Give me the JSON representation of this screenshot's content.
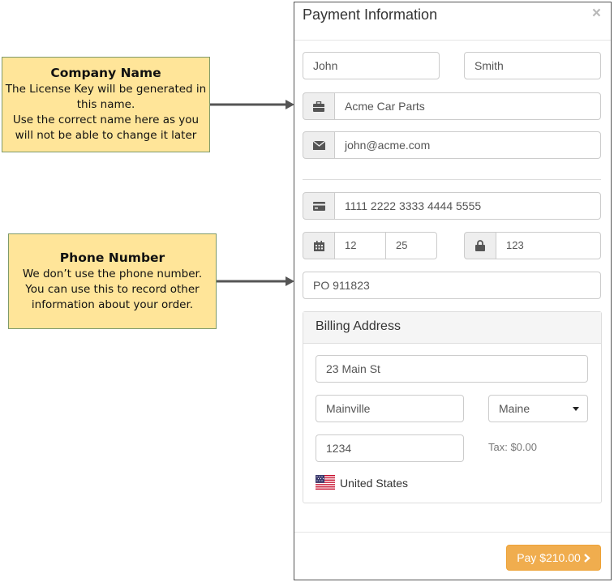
{
  "callouts": {
    "company": {
      "title": "Company Name",
      "body": "The License Key will be generated in\nthis name.\nUse the correct name here as you\nwill not be able to change it later"
    },
    "phone": {
      "title": "Phone Number",
      "body": "We don’t use the phone number.\nYou can use this to record other\ninformation about your order."
    }
  },
  "modal": {
    "title": "Payment Information",
    "close_glyph": "×"
  },
  "form": {
    "first_name": "John",
    "last_name": "Smith",
    "company": "Acme Car Parts",
    "email": "john@acme.com",
    "card_number": "1111 2222 3333 4444 5555",
    "exp_month": "12",
    "exp_year": "25",
    "cvc": "123",
    "phone": "PO 911823"
  },
  "billing": {
    "title": "Billing Address",
    "street": "23 Main St",
    "city": "Mainville",
    "state": "Maine",
    "zip": "1234",
    "tax": "Tax: $0.00",
    "country": "United States"
  },
  "footer": {
    "pay_label": "Pay $210.00"
  },
  "colors": {
    "callout_fill": "#ffe599",
    "pay_button": "#f0ad4e",
    "arrow": "#555555"
  }
}
